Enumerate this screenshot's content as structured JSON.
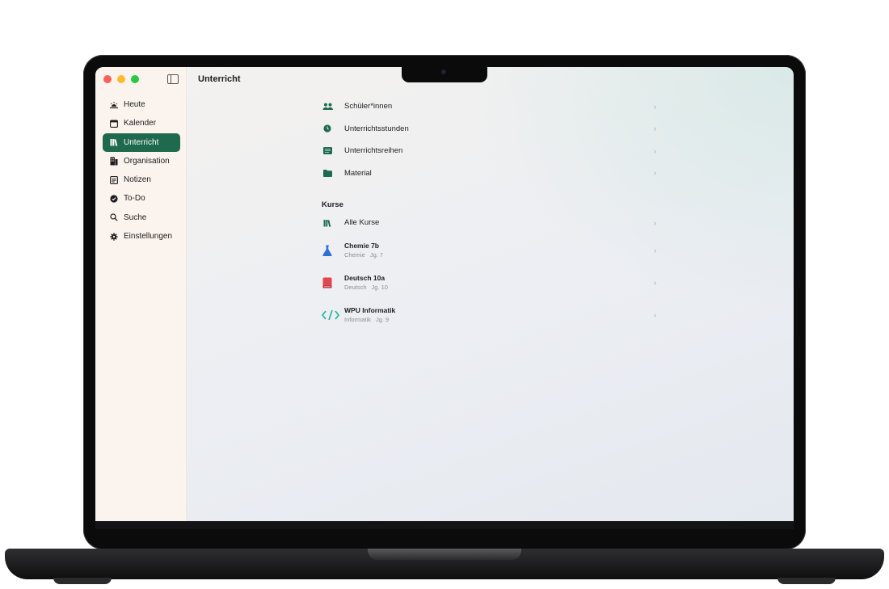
{
  "window": {
    "title": "Unterricht"
  },
  "colors": {
    "accent": "#1f6a4f",
    "chemistry": "#2f6fd6",
    "german": "#e2464f",
    "informatik": "#20b39b"
  },
  "sidebar": {
    "items": [
      {
        "label": "Heute",
        "icon": "sunrise-icon"
      },
      {
        "label": "Kalender",
        "icon": "calendar-icon"
      },
      {
        "label": "Unterricht",
        "icon": "books-icon",
        "active": true
      },
      {
        "label": "Organisation",
        "icon": "building-icon"
      },
      {
        "label": "Notizen",
        "icon": "notes-icon"
      },
      {
        "label": "To-Do",
        "icon": "checkmark-circle-icon"
      },
      {
        "label": "Suche",
        "icon": "search-icon"
      },
      {
        "label": "Einstellungen",
        "icon": "gear-icon"
      }
    ]
  },
  "main": {
    "items": [
      {
        "label": "Schüler*innen",
        "icon": "people-icon"
      },
      {
        "label": "Unterrichtsstunden",
        "icon": "clock-icon"
      },
      {
        "label": "Unterrichtsreihen",
        "icon": "list-icon"
      },
      {
        "label": "Material",
        "icon": "folder-icon"
      }
    ],
    "courses_section": {
      "title": "Kurse",
      "all_label": "Alle Kurse",
      "courses": [
        {
          "name": "Chemie 7b",
          "subject": "Chemie",
          "grade": "Jg. 7",
          "icon": "flask-icon"
        },
        {
          "name": "Deutsch 10a",
          "subject": "Deutsch",
          "grade": "Jg. 10",
          "icon": "book-icon"
        },
        {
          "name": "WPU Informatik",
          "subject": "Informatik",
          "grade": "Jg. 9",
          "icon": "code-icon"
        }
      ]
    },
    "chevron": "›"
  }
}
